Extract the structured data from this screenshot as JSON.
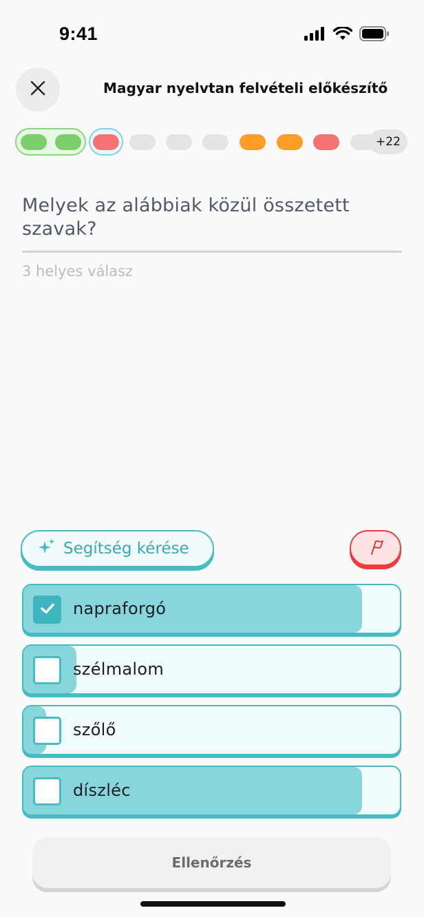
{
  "status_bar": {
    "time": "9:41"
  },
  "header": {
    "title": "Magyar nyelvtan felvételi előkészítő"
  },
  "progress": {
    "more_count": "+22",
    "colors": {
      "correct": "#7ccd6c",
      "wrong": "#f47274",
      "partial": "#ff9d26",
      "pending": "#e3e4e5"
    }
  },
  "question": {
    "text": "Melyek az alábbiak közül összetett szavak?",
    "hint": "3 helyes válasz"
  },
  "help": {
    "label": "Segítség kérése"
  },
  "options": [
    {
      "label": "napraforgó",
      "checked": true,
      "share": 0.9
    },
    {
      "label": "szélmalom",
      "checked": false,
      "share": 0.14
    },
    {
      "label": "szőlő",
      "checked": false,
      "share": 0.06
    },
    {
      "label": "díszléc",
      "checked": false,
      "share": 0.9
    }
  ],
  "footer": {
    "check_label": "Ellenőrzés"
  }
}
